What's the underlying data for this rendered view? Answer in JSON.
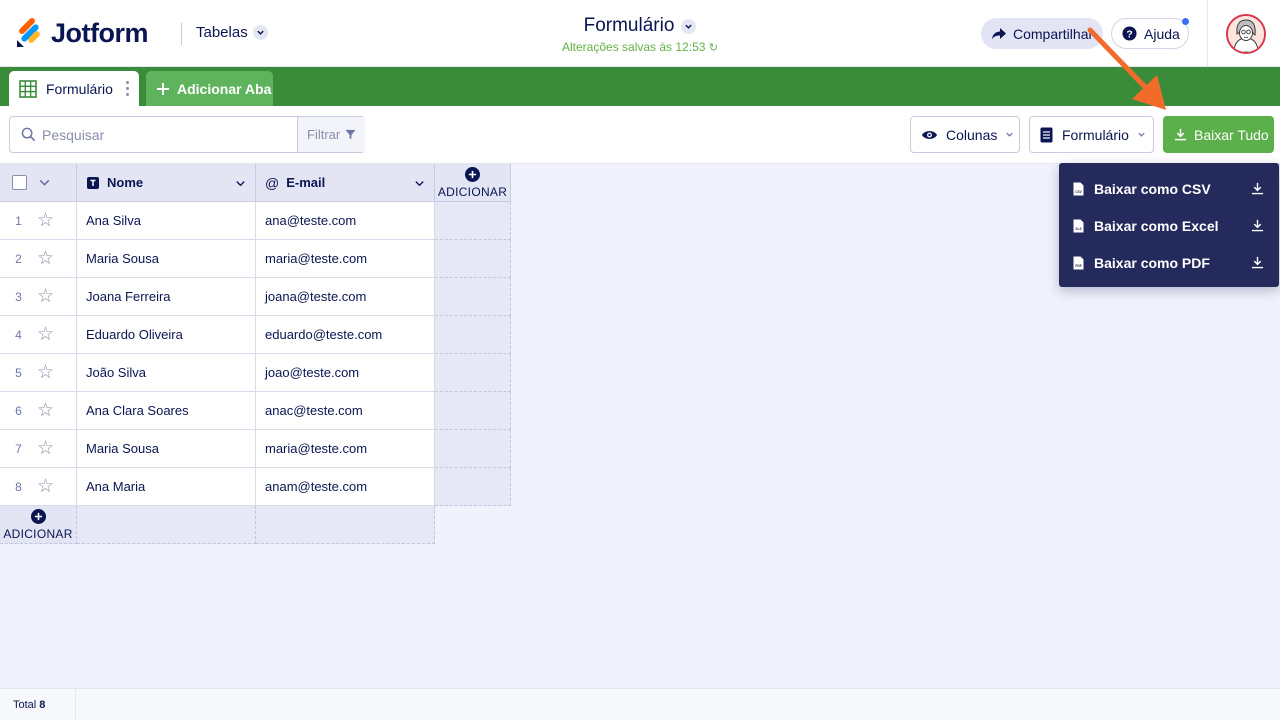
{
  "header": {
    "logo_text": "Jotform",
    "tables_menu": "Tabelas",
    "form_title": "Formulário",
    "saved_status": "Alterações salvas às 12:53",
    "share_label": "Compartilhar",
    "help_label": "Ajuda"
  },
  "tabs": [
    {
      "label": "Formulário"
    },
    {
      "label": "Adicionar Aba"
    }
  ],
  "toolbar": {
    "search_placeholder": "Pesquisar",
    "filter_label": "Filtrar",
    "columns_label": "Colunas",
    "form_label": "Formulário",
    "download_label": "Baixar Tudo"
  },
  "table": {
    "columns": [
      {
        "label": "Nome"
      },
      {
        "label": "E-mail"
      }
    ],
    "add_column_label": "ADICIONAR",
    "add_row_label": "ADICIONAR",
    "rows": [
      {
        "index": "1",
        "name": "Ana Silva",
        "email": "ana@teste.com"
      },
      {
        "index": "2",
        "name": "Maria Sousa",
        "email": "maria@teste.com"
      },
      {
        "index": "3",
        "name": "Joana Ferreira",
        "email": "joana@teste.com"
      },
      {
        "index": "4",
        "name": "Eduardo Oliveira",
        "email": "eduardo@teste.com"
      },
      {
        "index": "5",
        "name": "João Silva",
        "email": "joao@teste.com"
      },
      {
        "index": "6",
        "name": "Ana Clara Soares",
        "email": "anac@teste.com"
      },
      {
        "index": "7",
        "name": "Maria Sousa",
        "email": "maria@teste.com"
      },
      {
        "index": "8",
        "name": "Ana Maria",
        "email": "anam@teste.com"
      }
    ]
  },
  "download_menu": {
    "items": [
      {
        "label": "Baixar como CSV",
        "icon": "csv-file-icon"
      },
      {
        "label": "Baixar como Excel",
        "icon": "xls-file-icon"
      },
      {
        "label": "Baixar como PDF",
        "icon": "pdf-file-icon"
      }
    ]
  },
  "footer": {
    "total_label": "Total",
    "total_value": "8"
  },
  "colors": {
    "brand_navy": "#0a1551",
    "tab_bar_green": "#3b8c3a",
    "download_green": "#5bb04b",
    "dropdown_bg": "#252a5d",
    "annotation_arrow": "#f26b2a"
  }
}
